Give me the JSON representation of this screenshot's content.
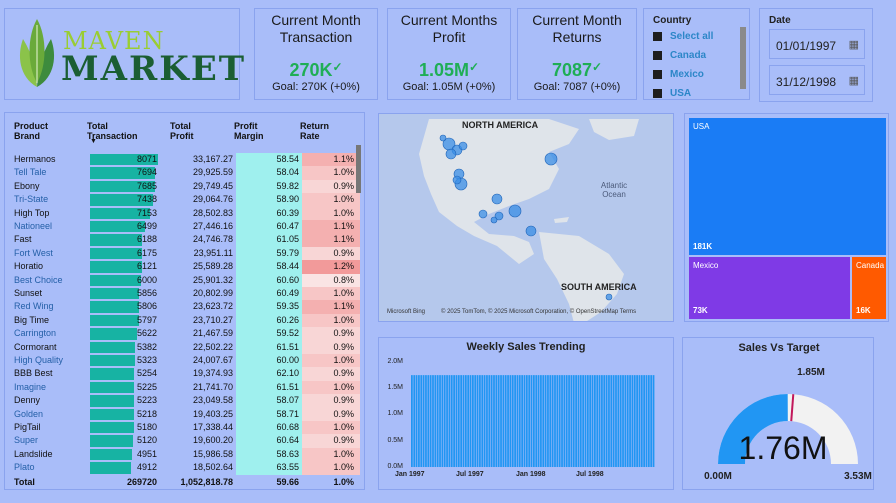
{
  "logo": {
    "line1": "MAVEN",
    "line2": "MARKET"
  },
  "kpis": [
    {
      "title": "Current Month Transaction",
      "value": "270K",
      "goal": "Goal: 270K (+0%)"
    },
    {
      "title": "Current Months Profit",
      "value": "1.05M",
      "goal": "Goal: 1.05M (+0%)"
    },
    {
      "title": "Current Month Returns",
      "value": "7087",
      "goal": "Goal: 7087 (+0%)"
    }
  ],
  "country_slicer": {
    "title": "Country",
    "items": [
      "Select all",
      "Canada",
      "Mexico",
      "USA"
    ]
  },
  "date_slicer": {
    "title": "Date",
    "start": "01/01/1997",
    "end": "31/12/1998"
  },
  "table": {
    "headers": [
      "Product Brand",
      "Total Transaction",
      "Total Profit",
      "Profit Margin",
      "Return Rate"
    ],
    "rows": [
      [
        "Hermanos",
        8071,
        "33,167.27",
        "58.54",
        "1.1%"
      ],
      [
        "Tell Tale",
        7694,
        "29,925.59",
        "58.04",
        "1.0%"
      ],
      [
        "Ebony",
        7685,
        "29,749.45",
        "59.82",
        "0.9%"
      ],
      [
        "Tri-State",
        7438,
        "29,064.76",
        "58.90",
        "1.0%"
      ],
      [
        "High Top",
        7153,
        "28,502.83",
        "60.39",
        "1.0%"
      ],
      [
        "Nationeel",
        6499,
        "27,446.16",
        "60.47",
        "1.1%"
      ],
      [
        "Fast",
        6188,
        "24,746.78",
        "61.05",
        "1.1%"
      ],
      [
        "Fort West",
        6175,
        "23,951.11",
        "59.79",
        "0.9%"
      ],
      [
        "Horatio",
        6121,
        "25,589.28",
        "58.44",
        "1.2%"
      ],
      [
        "Best Choice",
        6000,
        "25,901.32",
        "60.60",
        "0.8%"
      ],
      [
        "Sunset",
        5856,
        "20,802.99",
        "60.49",
        "1.0%"
      ],
      [
        "Red Wing",
        5806,
        "23,623.72",
        "59.35",
        "1.1%"
      ],
      [
        "Big Time",
        5797,
        "23,710.27",
        "60.26",
        "1.0%"
      ],
      [
        "Carrington",
        5622,
        "21,467.59",
        "59.52",
        "0.9%"
      ],
      [
        "Cormorant",
        5382,
        "22,502.22",
        "61.51",
        "0.9%"
      ],
      [
        "High Quality",
        5323,
        "24,007.67",
        "60.00",
        "1.0%"
      ],
      [
        "BBB Best",
        5254,
        "19,374.93",
        "62.10",
        "0.9%"
      ],
      [
        "Imagine",
        5225,
        "21,741.70",
        "61.51",
        "1.0%"
      ],
      [
        "Denny",
        5223,
        "23,049.58",
        "58.07",
        "0.9%"
      ],
      [
        "Golden",
        5218,
        "19,403.25",
        "58.71",
        "0.9%"
      ],
      [
        "PigTail",
        5180,
        "17,338.44",
        "60.68",
        "1.0%"
      ],
      [
        "Super",
        5120,
        "19,600.20",
        "60.64",
        "0.9%"
      ],
      [
        "Landslide",
        4951,
        "15,986.58",
        "58.63",
        "1.0%"
      ],
      [
        "Plato",
        4912,
        "18,502.64",
        "63.55",
        "1.0%"
      ]
    ],
    "total": [
      "Total",
      269720,
      "1,052,818.78",
      "59.66",
      "1.0%"
    ]
  },
  "map": {
    "labels": [
      "NORTH AMERICA",
      "SOUTH AMERICA"
    ],
    "ocean": "Atlantic Ocean",
    "brand": "Microsoft Bing",
    "credit": "© 2025 TomTom, © 2025 Microsoft Corporation, © OpenStreetMap  Terms"
  },
  "treemap": {
    "items": [
      {
        "label": "USA",
        "value": "181K"
      },
      {
        "label": "Mexico",
        "value": "73K"
      },
      {
        "label": "Canada",
        "value": "16K"
      }
    ]
  },
  "weekly": {
    "title": "Weekly Sales Trending",
    "yticks": [
      "2.0M",
      "1.5M",
      "1.0M",
      "0.5M",
      "0.0M"
    ],
    "xticks": [
      "Jan 1997",
      "Jul 1997",
      "Jan 1998",
      "Jul 1998"
    ]
  },
  "gauge": {
    "title": "Sales Vs Target",
    "value": "1.76M",
    "target": "1.85M",
    "min": "0.00M",
    "max": "3.53M"
  },
  "chart_data": [
    {
      "type": "bar",
      "title": "Weekly Sales Trending",
      "ylim": [
        0,
        2000000
      ],
      "x_range": [
        "Jan 1997",
        "Dec 1998"
      ],
      "bars": 104,
      "approx_value": 1750000
    },
    {
      "type": "gauge",
      "title": "Sales Vs Target",
      "value": 1.76,
      "target": 1.85,
      "min": 0,
      "max": 3.53,
      "unit": "M"
    },
    {
      "type": "treemap",
      "categories": [
        "USA",
        "Mexico",
        "Canada"
      ],
      "values": [
        181,
        73,
        16
      ],
      "unit": "K"
    }
  ],
  "colors": {
    "background": "#a9bdf9",
    "kpi_green": "#1fae55",
    "bar_teal": "#17b3a3",
    "margin_cyan": "#9ff0ee",
    "treemap_usa": "#1a7cf5",
    "treemap_mexico": "#7f3ae6",
    "treemap_canada": "#ff5a00",
    "gauge_fill": "#2196f3"
  }
}
